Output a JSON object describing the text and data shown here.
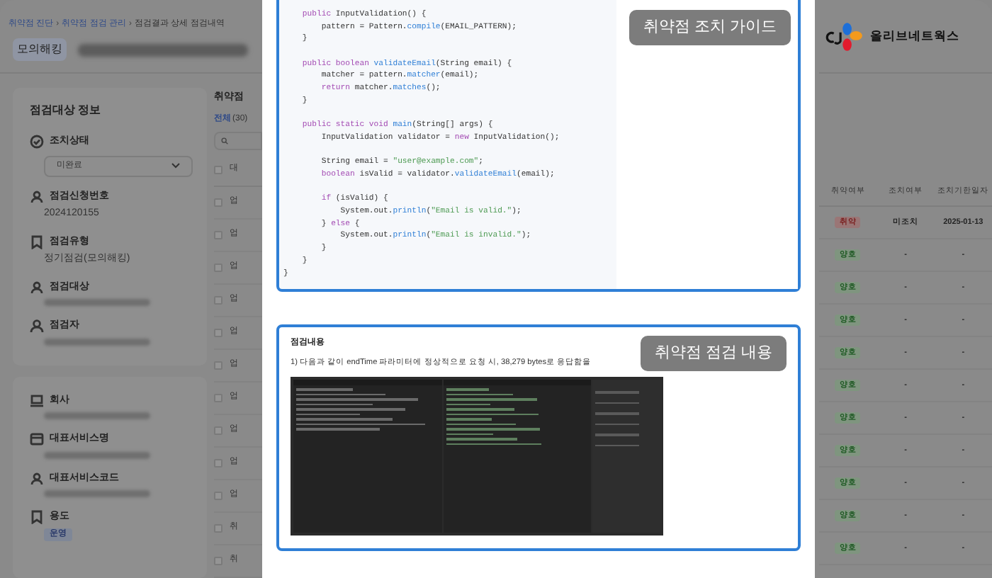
{
  "breadcrumb": {
    "separator": "›",
    "items": [
      "취약점 진단",
      "취약점 점검 관리",
      "점검결과 상세 점검내역"
    ]
  },
  "page_tag": "모의해킹",
  "info_card": {
    "title": "점검대상 정보",
    "items": [
      {
        "kind": "select",
        "label": "조치상태",
        "value": "미완료"
      },
      {
        "kind": "text",
        "label": "점검신청번호",
        "value": "2024120155"
      },
      {
        "kind": "text",
        "label": "점검유형",
        "value": "정기점검(모의해킹)"
      },
      {
        "kind": "blurred",
        "label": "점검대상"
      },
      {
        "kind": "blurred",
        "label": "점검자"
      }
    ]
  },
  "service_card": {
    "items": [
      {
        "kind": "blurred",
        "label": "회사"
      },
      {
        "kind": "blurred",
        "label": "대표서비스명"
      },
      {
        "kind": "blurred",
        "label": "대표서비스코드"
      },
      {
        "kind": "tag",
        "label": "용도",
        "value": "운영"
      }
    ]
  },
  "list": {
    "title": "취약점",
    "filter": "전체",
    "count": "(30)",
    "header": "대",
    "header_checked": false,
    "rows": [
      {
        "text": "업",
        "checked": false
      },
      {
        "text": "업",
        "checked": false
      },
      {
        "text": "업",
        "checked": false
      },
      {
        "text": "업",
        "checked": false
      },
      {
        "text": "업",
        "checked": false
      },
      {
        "text": "업",
        "checked": false
      },
      {
        "text": "업",
        "checked": false
      },
      {
        "text": "업",
        "checked": false
      },
      {
        "text": "업",
        "checked": false
      },
      {
        "text": "업",
        "checked": false
      },
      {
        "text": "취",
        "checked": false
      },
      {
        "text": "취",
        "checked": false
      }
    ]
  },
  "guide": {
    "badge": "취약점 조치 가이드",
    "code": [
      {
        "blank_before": false,
        "parts": [
          {
            "kind": "keyword",
            "text": "    public"
          },
          {
            "kind": "plain",
            "text": " InputValidation() {"
          }
        ]
      },
      {
        "blank_before": false,
        "parts": [
          {
            "kind": "plain",
            "text": "        pattern = Pattern."
          },
          {
            "kind": "function",
            "text": "compile"
          },
          {
            "kind": "plain",
            "text": "(EMAIL_PATTERN);"
          }
        ]
      },
      {
        "blank_before": false,
        "parts": [
          {
            "kind": "plain",
            "text": "    }"
          }
        ]
      },
      {
        "blank_before": true,
        "parts": [
          {
            "kind": "keyword",
            "text": "    public boolean "
          },
          {
            "kind": "function",
            "text": "validateEmail"
          },
          {
            "kind": "plain",
            "text": "(String email) {"
          }
        ]
      },
      {
        "blank_before": false,
        "parts": [
          {
            "kind": "plain",
            "text": "        matcher = pattern."
          },
          {
            "kind": "function",
            "text": "matcher"
          },
          {
            "kind": "plain",
            "text": "(email);"
          }
        ]
      },
      {
        "blank_before": false,
        "parts": [
          {
            "kind": "keyword",
            "text": "        return"
          },
          {
            "kind": "plain",
            "text": " matcher."
          },
          {
            "kind": "function",
            "text": "matches"
          },
          {
            "kind": "plain",
            "text": "();"
          }
        ]
      },
      {
        "blank_before": false,
        "parts": [
          {
            "kind": "plain",
            "text": "    }"
          }
        ]
      },
      {
        "blank_before": true,
        "parts": [
          {
            "kind": "keyword",
            "text": "    public static void "
          },
          {
            "kind": "function",
            "text": "main"
          },
          {
            "kind": "plain",
            "text": "(String[] args) {"
          }
        ]
      },
      {
        "blank_before": false,
        "parts": [
          {
            "kind": "plain",
            "text": "        InputValidation validator = "
          },
          {
            "kind": "keyword",
            "text": "new"
          },
          {
            "kind": "plain",
            "text": " InputValidation();"
          }
        ]
      },
      {
        "blank_before": true,
        "parts": [
          {
            "kind": "plain",
            "text": "        String email = "
          },
          {
            "kind": "string",
            "text": "\"user@example.com\""
          },
          {
            "kind": "plain",
            "text": ";"
          }
        ]
      },
      {
        "blank_before": false,
        "parts": [
          {
            "kind": "keyword",
            "text": "        boolean"
          },
          {
            "kind": "plain",
            "text": " isValid = validator."
          },
          {
            "kind": "function",
            "text": "validateEmail"
          },
          {
            "kind": "plain",
            "text": "(email);"
          }
        ]
      },
      {
        "blank_before": true,
        "parts": [
          {
            "kind": "keyword",
            "text": "        if"
          },
          {
            "kind": "plain",
            "text": " (isValid) {"
          }
        ]
      },
      {
        "blank_before": false,
        "parts": [
          {
            "kind": "plain",
            "text": "            System.out."
          },
          {
            "kind": "function",
            "text": "println"
          },
          {
            "kind": "plain",
            "text": "("
          },
          {
            "kind": "string",
            "text": "\"Email is valid.\""
          },
          {
            "kind": "plain",
            "text": ");"
          }
        ]
      },
      {
        "blank_before": false,
        "parts": [
          {
            "kind": "plain",
            "text": "        } "
          },
          {
            "kind": "keyword",
            "text": "else"
          },
          {
            "kind": "plain",
            "text": " {"
          }
        ]
      },
      {
        "blank_before": false,
        "parts": [
          {
            "kind": "plain",
            "text": "            System.out."
          },
          {
            "kind": "function",
            "text": "println"
          },
          {
            "kind": "plain",
            "text": "("
          },
          {
            "kind": "string",
            "text": "\"Email is invalid.\""
          },
          {
            "kind": "plain",
            "text": ");"
          }
        ]
      },
      {
        "blank_before": false,
        "parts": [
          {
            "kind": "plain",
            "text": "        }"
          }
        ]
      },
      {
        "blank_before": false,
        "parts": [
          {
            "kind": "plain",
            "text": "    }"
          }
        ]
      },
      {
        "blank_before": false,
        "parts": [
          {
            "kind": "plain",
            "text": "}"
          }
        ]
      }
    ]
  },
  "inspection": {
    "badge": "취약점 점검 내용",
    "heading": "점검내용",
    "text": "1) 다음과 같이 endTime 파라미터에 정상적으로 요청 시, 38,279 bytes로 응답함을"
  },
  "results": {
    "columns": [
      "취약여부",
      "조치여부",
      "조치기한일자"
    ],
    "rows": [
      {
        "status": "취약",
        "kind": "vulnerable",
        "action": "미조치",
        "due": "2025-01-13"
      },
      {
        "status": "양호",
        "kind": "good",
        "action": "-",
        "due": "-"
      },
      {
        "status": "양호",
        "kind": "good",
        "action": "-",
        "due": "-"
      },
      {
        "status": "양호",
        "kind": "good",
        "action": "-",
        "due": "-"
      },
      {
        "status": "양호",
        "kind": "good",
        "action": "-",
        "due": "-"
      },
      {
        "status": "양호",
        "kind": "good",
        "action": "-",
        "due": "-"
      },
      {
        "status": "양호",
        "kind": "good",
        "action": "-",
        "due": "-"
      },
      {
        "status": "양호",
        "kind": "good",
        "action": "-",
        "due": "-"
      },
      {
        "status": "양호",
        "kind": "good",
        "action": "-",
        "due": "-"
      },
      {
        "status": "양호",
        "kind": "good",
        "action": "-",
        "due": "-"
      },
      {
        "status": "양호",
        "kind": "good",
        "action": "-",
        "due": "-"
      }
    ]
  },
  "logo": {
    "text": "올리브네트웍스"
  }
}
